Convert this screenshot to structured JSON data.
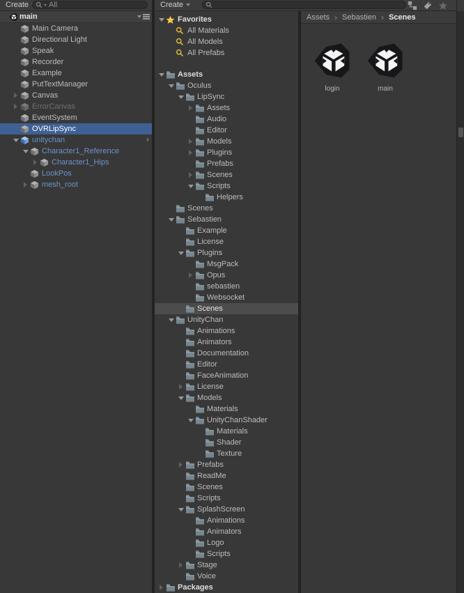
{
  "colors": {
    "selection_blue": "#3e6093",
    "selection_gray": "#4c4c4c",
    "prefab_text_blue": "#6d92cc",
    "favorites_yellow": "#f5c842",
    "panel_background": "#383838",
    "toolbar_background": "#3c3c3c"
  },
  "hierarchy": {
    "create_button": "Create",
    "search_filter_label": "All",
    "scene_header": {
      "name": "main",
      "menu_icon": "hamburger-menu-icon"
    },
    "items": [
      {
        "label": "Main Camera",
        "level": 1,
        "icon": "cube",
        "arrow": "none",
        "state": "normal"
      },
      {
        "label": "Directional Light",
        "level": 1,
        "icon": "cube",
        "arrow": "none",
        "state": "normal"
      },
      {
        "label": "Speak",
        "level": 1,
        "icon": "cube",
        "arrow": "none",
        "state": "normal"
      },
      {
        "label": "Recorder",
        "level": 1,
        "icon": "cube",
        "arrow": "none",
        "state": "normal"
      },
      {
        "label": "Example",
        "level": 1,
        "icon": "cube",
        "arrow": "none",
        "state": "normal"
      },
      {
        "label": "PutTextManager",
        "level": 1,
        "icon": "cube",
        "arrow": "none",
        "state": "normal"
      },
      {
        "label": "Canvas",
        "level": 1,
        "icon": "cube",
        "arrow": "collapsed",
        "state": "normal"
      },
      {
        "label": "ErrorCanvas",
        "level": 1,
        "icon": "cube",
        "arrow": "collapsed",
        "state": "disabled"
      },
      {
        "label": "EventSystem",
        "level": 1,
        "icon": "cube",
        "arrow": "none",
        "state": "normal"
      },
      {
        "label": "OVRLipSync",
        "level": 1,
        "icon": "cube",
        "arrow": "none",
        "state": "selected"
      },
      {
        "label": "unitychan",
        "level": 1,
        "icon": "prefab-cube",
        "arrow": "expanded",
        "state": "prefab",
        "trailing": "chevron"
      },
      {
        "label": "Character1_Reference",
        "level": 2,
        "icon": "cube",
        "arrow": "expanded",
        "state": "prefab"
      },
      {
        "label": "Character1_Hips",
        "level": 3,
        "icon": "cube",
        "arrow": "collapsed",
        "state": "prefab"
      },
      {
        "label": "LookPos",
        "level": 2,
        "icon": "cube",
        "arrow": "none",
        "state": "prefab"
      },
      {
        "label": "mesh_root",
        "level": 2,
        "icon": "cube",
        "arrow": "collapsed",
        "state": "prefab"
      }
    ]
  },
  "project": {
    "create_button": "Create",
    "search_placeholder": "",
    "toolbar_icons": [
      {
        "name": "search-by-type-icon"
      },
      {
        "name": "search-by-label-icon"
      },
      {
        "name": "save-search-star-icon"
      }
    ],
    "tree": [
      {
        "label": "Favorites",
        "level": 0,
        "icon": "star",
        "arrow": "expanded",
        "bold": true
      },
      {
        "label": "All Materials",
        "level": 1,
        "icon": "search"
      },
      {
        "label": "All Models",
        "level": 1,
        "icon": "search"
      },
      {
        "label": "All Prefabs",
        "level": 1,
        "icon": "search"
      },
      {
        "type": "spacer"
      },
      {
        "label": "Assets",
        "level": 0,
        "icon": "folder",
        "arrow": "expanded",
        "bold": true
      },
      {
        "label": "Oculus",
        "level": 1,
        "icon": "folder",
        "arrow": "expanded"
      },
      {
        "label": "LipSync",
        "level": 2,
        "icon": "folder",
        "arrow": "expanded"
      },
      {
        "label": "Assets",
        "level": 3,
        "icon": "folder",
        "arrow": "collapsed"
      },
      {
        "label": "Audio",
        "level": 3,
        "icon": "folder"
      },
      {
        "label": "Editor",
        "level": 3,
        "icon": "folder"
      },
      {
        "label": "Models",
        "level": 3,
        "icon": "folder",
        "arrow": "collapsed"
      },
      {
        "label": "Plugins",
        "level": 3,
        "icon": "folder",
        "arrow": "collapsed"
      },
      {
        "label": "Prefabs",
        "level": 3,
        "icon": "folder"
      },
      {
        "label": "Scenes",
        "level": 3,
        "icon": "folder",
        "arrow": "collapsed"
      },
      {
        "label": "Scripts",
        "level": 3,
        "icon": "folder",
        "arrow": "expanded"
      },
      {
        "label": "Helpers",
        "level": 4,
        "icon": "folder"
      },
      {
        "label": "Scenes",
        "level": 1,
        "icon": "folder"
      },
      {
        "label": "Sebastien",
        "level": 1,
        "icon": "folder",
        "arrow": "expanded"
      },
      {
        "label": "Example",
        "level": 2,
        "icon": "folder"
      },
      {
        "label": "License",
        "level": 2,
        "icon": "folder"
      },
      {
        "label": "Plugins",
        "level": 2,
        "icon": "folder",
        "arrow": "expanded"
      },
      {
        "label": "MsgPack",
        "level": 3,
        "icon": "folder"
      },
      {
        "label": "Opus",
        "level": 3,
        "icon": "folder",
        "arrow": "collapsed"
      },
      {
        "label": "sebastien",
        "level": 3,
        "icon": "folder"
      },
      {
        "label": "Websocket",
        "level": 3,
        "icon": "folder"
      },
      {
        "label": "Scenes",
        "level": 2,
        "icon": "folder",
        "state": "selected"
      },
      {
        "label": "UnityChan",
        "level": 1,
        "icon": "folder",
        "arrow": "expanded"
      },
      {
        "label": "Animations",
        "level": 2,
        "icon": "folder"
      },
      {
        "label": "Animators",
        "level": 2,
        "icon": "folder"
      },
      {
        "label": "Documentation",
        "level": 2,
        "icon": "folder"
      },
      {
        "label": "Editor",
        "level": 2,
        "icon": "folder"
      },
      {
        "label": "FaceAnimation",
        "level": 2,
        "icon": "folder"
      },
      {
        "label": "License",
        "level": 2,
        "icon": "folder",
        "arrow": "collapsed"
      },
      {
        "label": "Models",
        "level": 2,
        "icon": "folder",
        "arrow": "expanded"
      },
      {
        "label": "Materials",
        "level": 3,
        "icon": "folder"
      },
      {
        "label": "UnityChanShader",
        "level": 3,
        "icon": "folder",
        "arrow": "expanded"
      },
      {
        "label": "Materials",
        "level": 4,
        "icon": "folder"
      },
      {
        "label": "Shader",
        "level": 4,
        "icon": "folder"
      },
      {
        "label": "Texture",
        "level": 4,
        "icon": "folder"
      },
      {
        "label": "Prefabs",
        "level": 2,
        "icon": "folder",
        "arrow": "collapsed"
      },
      {
        "label": "ReadMe",
        "level": 2,
        "icon": "folder"
      },
      {
        "label": "Scenes",
        "level": 2,
        "icon": "folder"
      },
      {
        "label": "Scripts",
        "level": 2,
        "icon": "folder"
      },
      {
        "label": "SplashScreen",
        "level": 2,
        "icon": "folder",
        "arrow": "expanded"
      },
      {
        "label": "Animations",
        "level": 3,
        "icon": "folder"
      },
      {
        "label": "Animators",
        "level": 3,
        "icon": "folder"
      },
      {
        "label": "Logo",
        "level": 3,
        "icon": "folder"
      },
      {
        "label": "Scripts",
        "level": 3,
        "icon": "folder"
      },
      {
        "label": "Stage",
        "level": 2,
        "icon": "folder",
        "arrow": "collapsed"
      },
      {
        "label": "Voice",
        "level": 2,
        "icon": "folder"
      },
      {
        "label": "Packages",
        "level": 0,
        "icon": "folder",
        "arrow": "collapsed",
        "bold": true
      }
    ],
    "breadcrumb": [
      {
        "label": "Assets",
        "current": false
      },
      {
        "label": "Sebastien",
        "current": false
      },
      {
        "label": "Scenes",
        "current": true
      }
    ],
    "assets": [
      {
        "label": "login",
        "icon": "unity-scene"
      },
      {
        "label": "main",
        "icon": "unity-scene"
      }
    ]
  }
}
